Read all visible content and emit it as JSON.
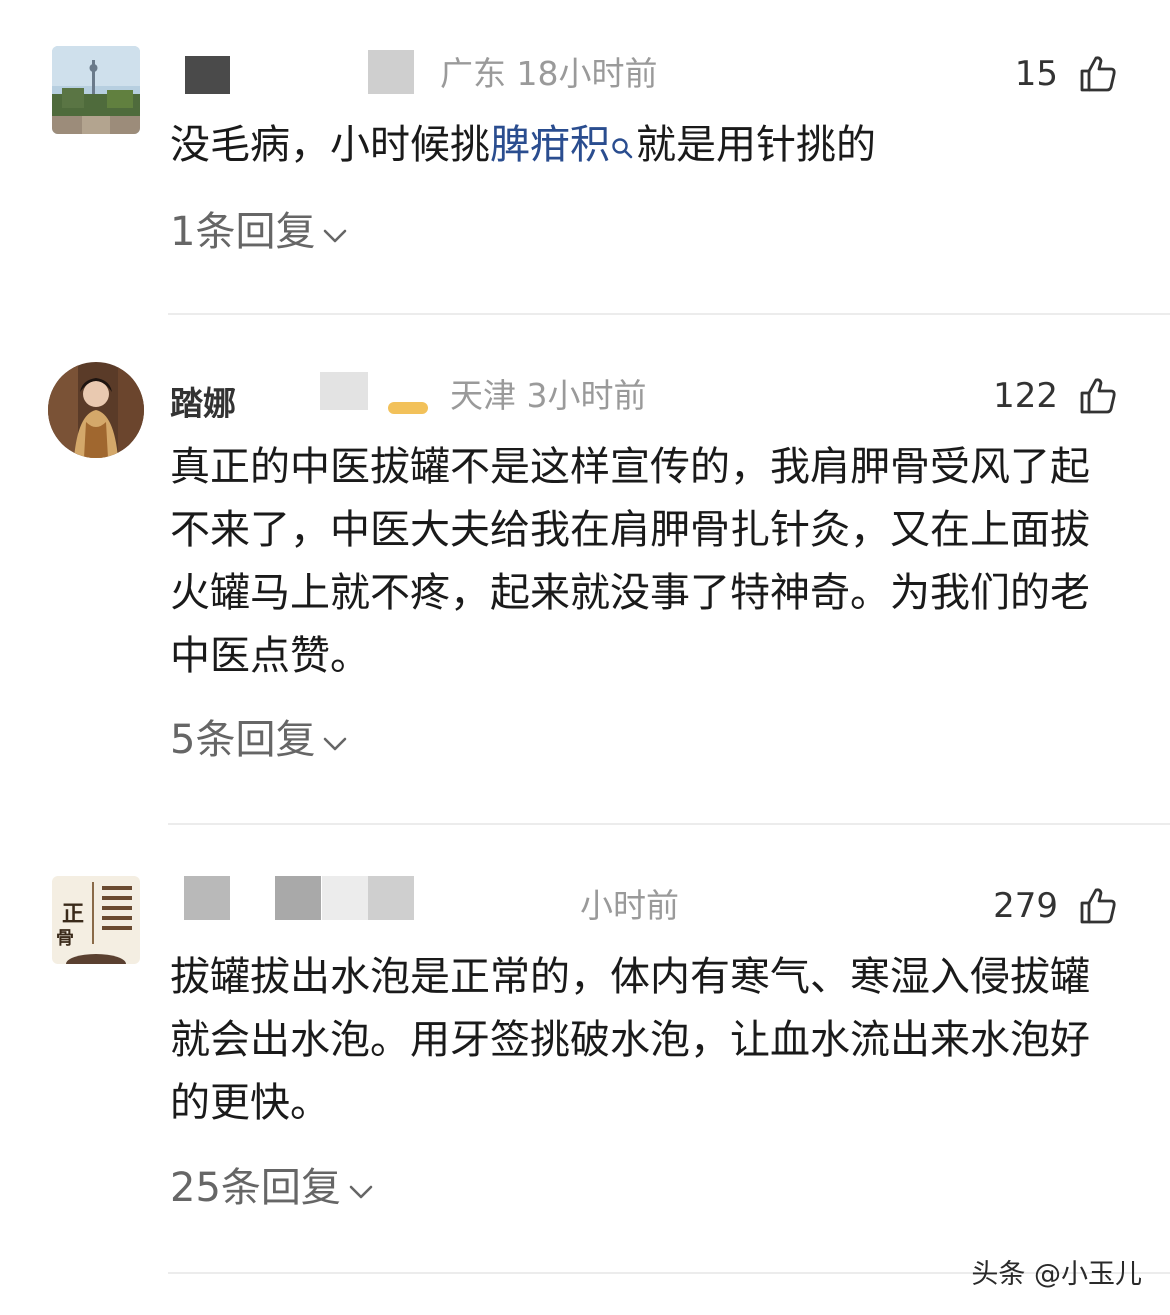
{
  "comments": [
    {
      "location": "广东",
      "time": "18小时前",
      "likes": "15",
      "text_pre": "没毛病，小时候挑",
      "keyword": "脾疳积",
      "text_post": "就是用针挑的",
      "replies": "1条回复"
    },
    {
      "username_fragment": "踏娜",
      "location": "天津",
      "time": "3小时前",
      "likes": "122",
      "text": "真正的中医拔罐不是这样宣传的，我肩胛骨受风了起不来了，中医大夫给我在肩胛骨扎针灸，又在上面拔火罐马上就不疼，起来就没事了特神奇。为我们的老中医点赞。",
      "replies": "5条回复"
    },
    {
      "avatar_glyphs": [
        "正",
        "骨"
      ],
      "time": "小时前",
      "likes": "279",
      "text": "拔罐拔出水泡是正常的，体内有寒气、寒湿入侵拔罐就会出水泡。用牙签挑破水泡，让血水流出来水泡好的更快。",
      "replies": "25条回复"
    }
  ],
  "watermark": "头条 @小玉儿",
  "colors": {
    "keyword": "#2a4d8f",
    "meta": "#9a9a9a",
    "body": "#1a1a1a",
    "divider": "#ececec"
  },
  "icons": [
    "thumbs-up-icon",
    "chevron-down-icon",
    "search-icon"
  ]
}
